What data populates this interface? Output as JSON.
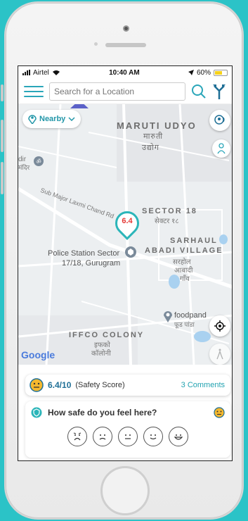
{
  "status": {
    "carrier": "Airtel",
    "time": "10:40 AM",
    "battery": "60%"
  },
  "search": {
    "placeholder": "Search for a Location"
  },
  "nearby": {
    "label": "Nearby"
  },
  "map": {
    "labels": {
      "maruti": "MARUTI UDYO",
      "maruti_hi_1": "मारुती",
      "maruti_hi_2": "उद्योग",
      "sector18": "SECTOR 18",
      "sector18_hi": "सेक्टर १८",
      "sarhaul": "SARHAUL",
      "abadi": "ABADI VILLAGE",
      "sarhaul_hi_1": "सरहोल",
      "sarhaul_hi_2": "आबादी",
      "sarhaul_hi_3": "गाँव",
      "road": "Sub Major Laxmi Chand Rd",
      "police": "Police Station Sector",
      "police_2": "17/18, Gurugram",
      "foodpanda": "foodpand",
      "foodpanda_hi": "फूड पांडा",
      "iffco": "IFFCO COLONY",
      "iffco_hi_1": "इफको",
      "iffco_hi_2": "कॉलोनी",
      "dir": "dir",
      "mandir": "मंदिर",
      "google": "Google"
    },
    "pin_score": "6.4"
  },
  "safety": {
    "score": "6.4/10",
    "score_label": "(Safety Score)",
    "comments": "3 Comments"
  },
  "feedback": {
    "question": "How safe do you feel here?"
  },
  "colors": {
    "accent": "#2aa6b9",
    "background": "#2bc3c7",
    "pin_text": "#e53935"
  },
  "icons": [
    "menu-icon",
    "search-icon",
    "route-icon",
    "location-pin-icon",
    "chevron-down-icon",
    "voice-icon",
    "person-pin-icon",
    "my-location-icon",
    "walk-icon",
    "emoji-icon",
    "shield-icon"
  ]
}
